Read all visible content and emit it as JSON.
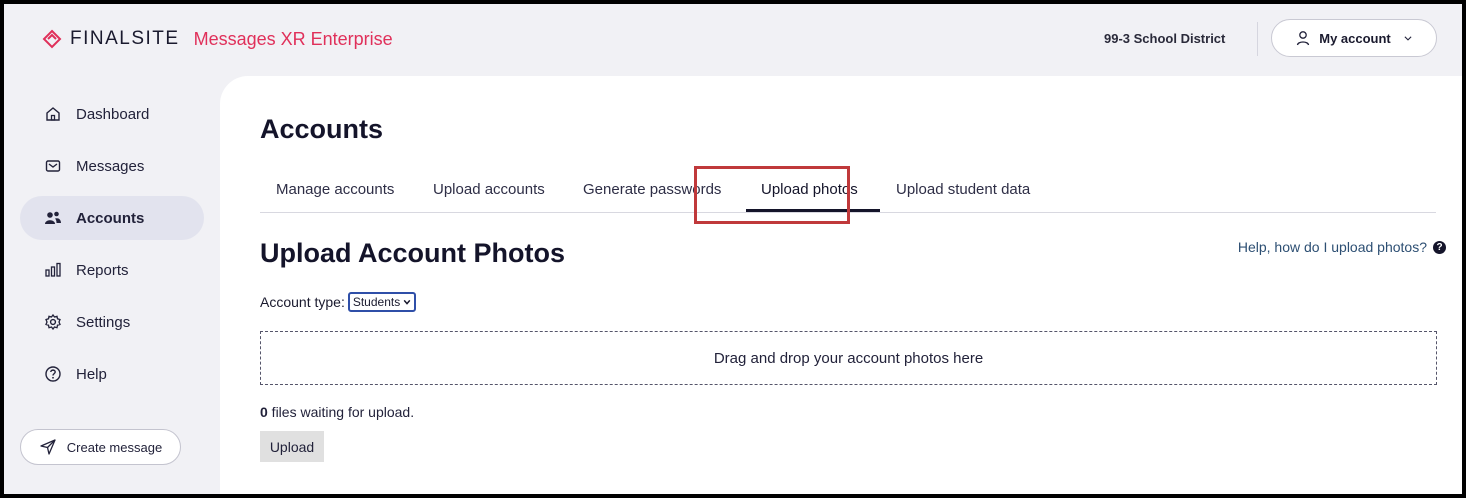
{
  "header": {
    "brand": "FINALSITE",
    "product": "Messages XR Enterprise",
    "district": "99-3 School District",
    "account_label": "My account",
    "brand_color": "#e0305a"
  },
  "sidebar": {
    "items": [
      {
        "label": "Dashboard",
        "icon": "home-icon"
      },
      {
        "label": "Messages",
        "icon": "envelope-icon"
      },
      {
        "label": "Accounts",
        "icon": "users-icon"
      },
      {
        "label": "Reports",
        "icon": "bar-chart-icon"
      },
      {
        "label": "Settings",
        "icon": "gear-icon"
      },
      {
        "label": "Help",
        "icon": "help-circle-icon"
      }
    ],
    "active": "Accounts",
    "create_label": "Create message"
  },
  "main": {
    "title": "Accounts",
    "tabs": [
      {
        "label": "Manage accounts"
      },
      {
        "label": "Upload accounts"
      },
      {
        "label": "Generate passwords"
      },
      {
        "label": "Upload photos"
      },
      {
        "label": "Upload student data"
      }
    ],
    "active_tab": "Upload photos",
    "section_title": "Upload Account Photos",
    "help_link": "Help, how do I upload photos?",
    "account_type_label": "Account type:",
    "account_type_value": "Students",
    "dropzone_text": "Drag and drop your account photos here",
    "waiting_count": "0",
    "waiting_text": " files waiting for upload.",
    "upload_label": "Upload",
    "highlight_color": "#c0393b"
  }
}
